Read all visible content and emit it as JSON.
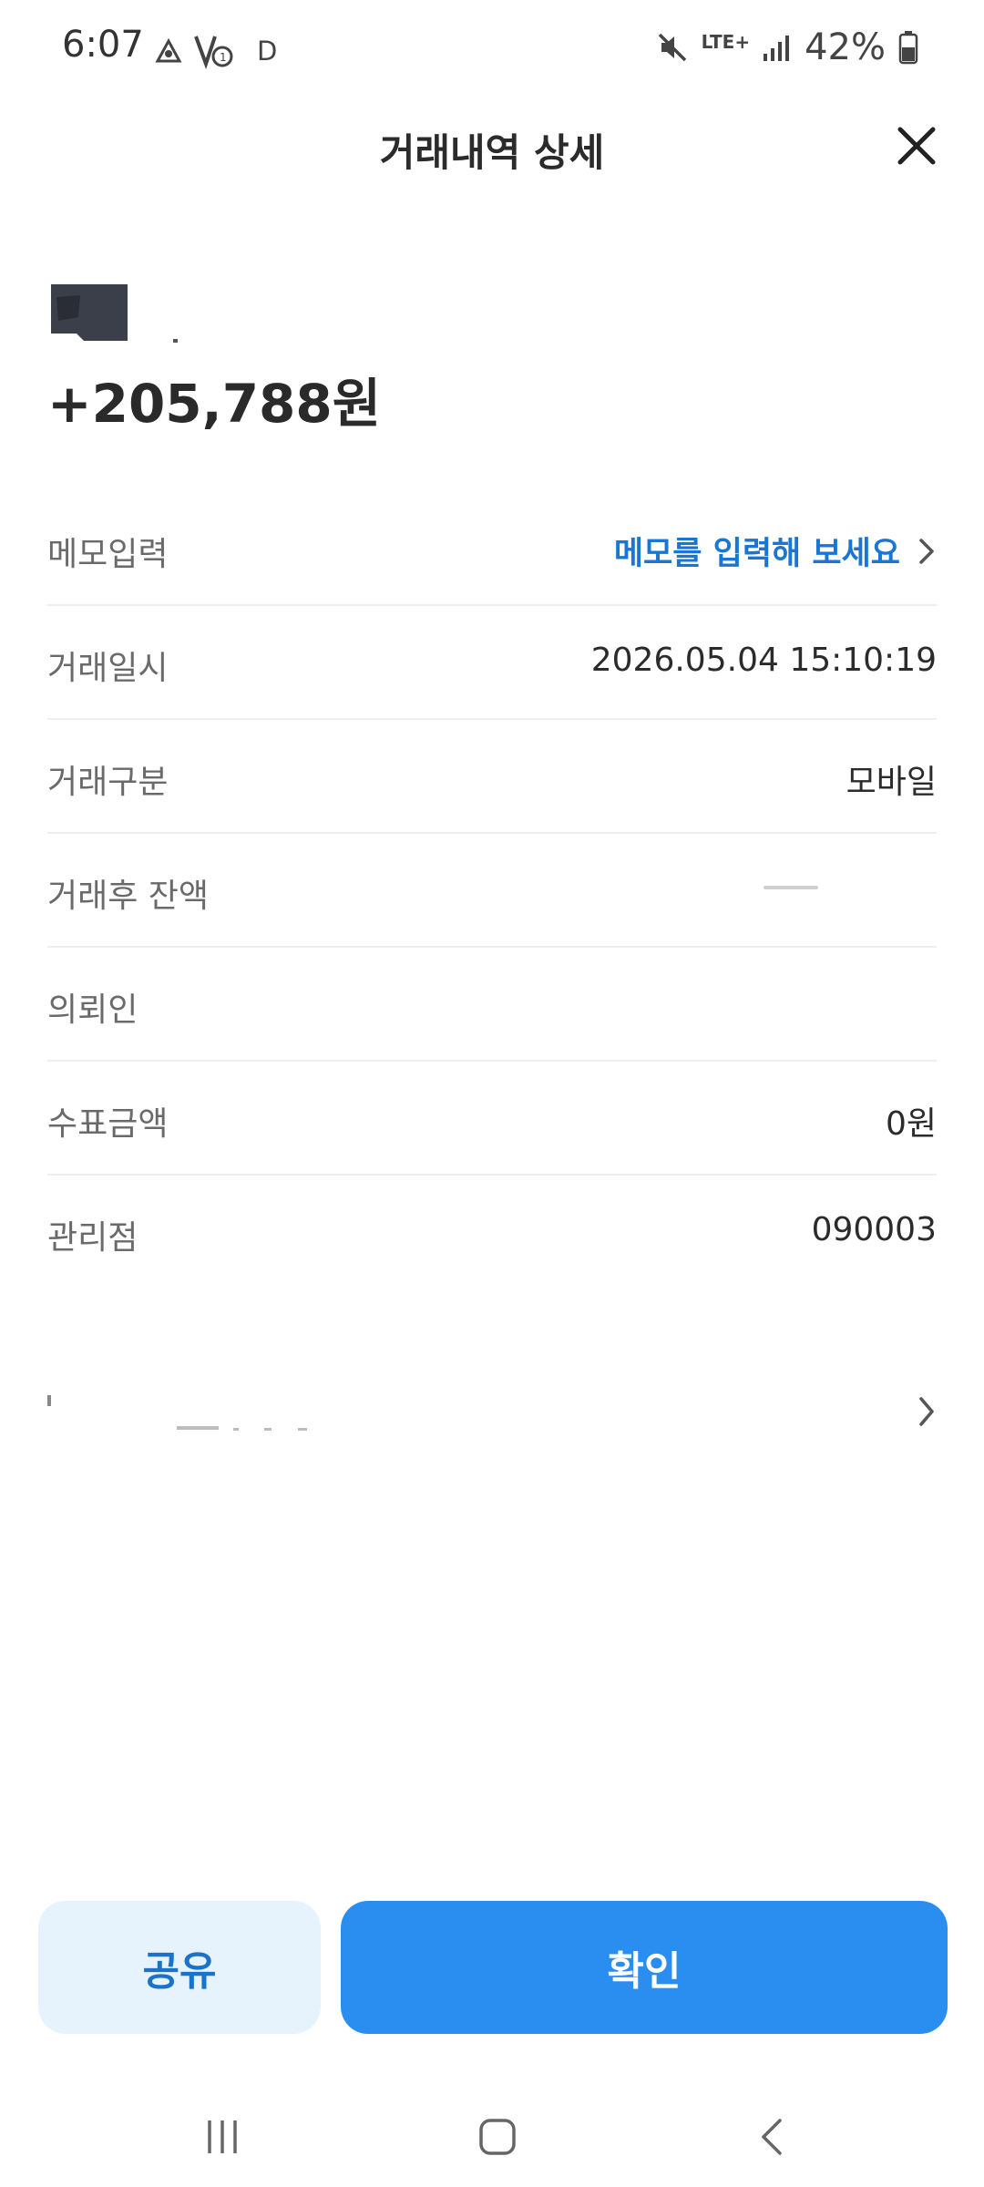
{
  "status_bar": {
    "time": "6:07",
    "carrier_letter": "D",
    "network": "LTE+",
    "battery": "42%"
  },
  "header": {
    "title": "거래내역 상세"
  },
  "summary": {
    "amount": "+205,788원"
  },
  "details": {
    "memo": {
      "label": "메모입력",
      "link_text": "메모를 입력해 보세요"
    },
    "datetime": {
      "label": "거래일시",
      "value": "2026.05.04 15:10:19"
    },
    "type": {
      "label": "거래구분",
      "value": "모바일"
    },
    "balance": {
      "label": "거래후 잔액"
    },
    "requester": {
      "label": "의뢰인"
    },
    "check_amount": {
      "label": "수표금액",
      "value": "0원"
    },
    "branch": {
      "label": "관리점",
      "value": "090003"
    }
  },
  "buttons": {
    "share": "공유",
    "confirm": "확인"
  },
  "colors": {
    "link_blue": "#1976d2",
    "primary_button": "#2a8ef1",
    "secondary_button_bg": "#e6f3fd",
    "secondary_button_text": "#1a73c8"
  },
  "icons": [
    "close-icon",
    "chevron-right-icon",
    "mute-icon",
    "signal-icon",
    "battery-icon",
    "recent-apps-icon",
    "home-icon",
    "back-icon"
  ]
}
